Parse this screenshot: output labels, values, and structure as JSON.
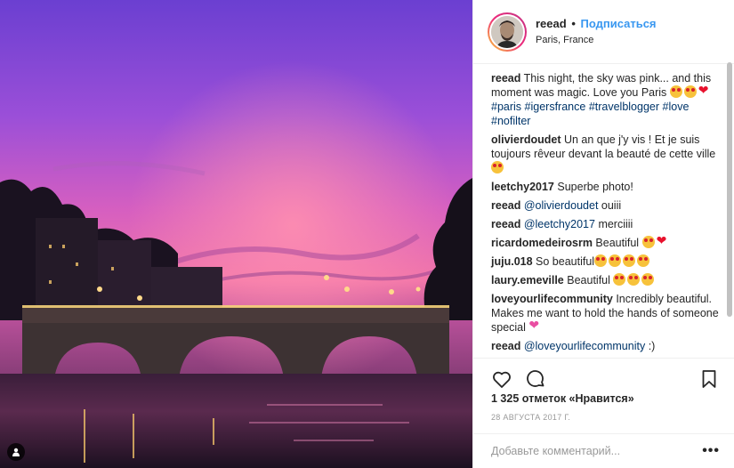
{
  "post": {
    "username": "reead",
    "follow_label": "Подписаться",
    "separator": "•",
    "location": "Paris, France"
  },
  "comments": [
    {
      "user": "reead",
      "text": "This night, the sky was pink... and this moment was magic. Love you Paris ",
      "emojis": [
        "face-grin",
        "face-wink",
        "heart"
      ],
      "tags": [
        "#paris",
        "#igersfrance",
        "#travelblogger",
        "#love",
        "#nofilter"
      ]
    },
    {
      "user": "olivierdoudet",
      "text": "Un an que j'y vis ! Et je suis toujours rêveur devant la beauté de cette ville",
      "emojis": [
        "face-heart-eyes"
      ]
    },
    {
      "user": "leetchy2017",
      "text": "Superbe photo!"
    },
    {
      "user": "reead",
      "mention": "@olivierdoudet",
      "text": "ouiii"
    },
    {
      "user": "reead",
      "mention": "@leetchy2017",
      "text": "merciiii"
    },
    {
      "user": "ricardomedeirosrm",
      "text": "Beautiful",
      "emojis": [
        "face-heart-eyes",
        "heart"
      ]
    },
    {
      "user": "juju.018",
      "text": "So beautiful",
      "emojis": [
        "face-heart-eyes",
        "face-heart-eyes",
        "face-heart-eyes",
        "face-heart-eyes"
      ]
    },
    {
      "user": "laury.emeville",
      "text": "Beautiful",
      "emojis": [
        "face-heart-eyes",
        "face-heart-eyes",
        "face-heart-eyes"
      ]
    },
    {
      "user": "loveyourlifecommunity",
      "text": "Incredibly beautiful. Makes me want to hold the hands of someone special",
      "emojis": [
        "heart-sparkle"
      ]
    },
    {
      "user": "reead",
      "mention": "@loveyourlifecommunity",
      "text": ":)"
    }
  ],
  "actions": {
    "like_icon": "heart-outline-icon",
    "comment_icon": "comment-bubble-icon",
    "save_icon": "bookmark-icon"
  },
  "likes_text": "1 325 отметок «Нравится»",
  "date_text": "28 августа 2017 г.",
  "add_comment": {
    "placeholder": "Добавьте комментарий...",
    "more_label": "•••"
  },
  "colors": {
    "link": "#3897f0",
    "hashtag": "#003569",
    "border": "#efefef",
    "sky_top": "#6b3fd1",
    "sky_mid": "#e25fb5",
    "sky_glow": "#ff7aa0"
  }
}
